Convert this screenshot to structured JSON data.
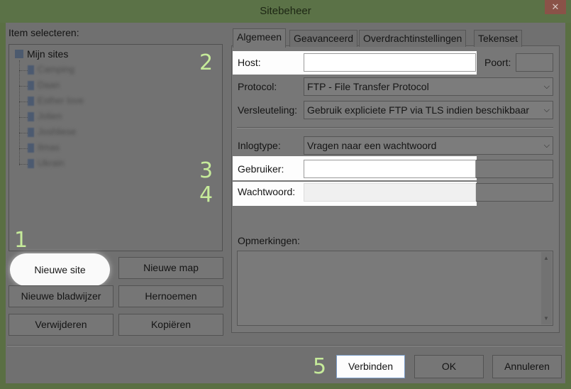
{
  "window": {
    "title": "Sitebeheer",
    "close_glyph": "✕"
  },
  "left": {
    "select_label": "Item selecteren:",
    "tree_root": "Mijn sites",
    "tree_items": [
      "Camping",
      "Daan",
      "Esther love",
      "Jolien",
      "Joshliese",
      "Ilmas",
      "Ukrain"
    ]
  },
  "buttons": {
    "new_site": "Nieuwe site",
    "new_folder": "Nieuwe map",
    "new_bookmark": "Nieuwe bladwijzer",
    "rename": "Hernoemen",
    "delete": "Verwijderen",
    "copy": "Kopiëren",
    "connect": "Verbinden",
    "ok": "OK",
    "cancel": "Annuleren"
  },
  "tabs": [
    "Algemeen",
    "Geavanceerd",
    "Overdrachtinstellingen",
    "Tekenset"
  ],
  "form": {
    "host_label": "Host:",
    "host_value": "",
    "port_label": "Poort:",
    "port_value": "",
    "protocol_label": "Protocol:",
    "protocol_value": "FTP - File Transfer Protocol",
    "encryption_label": "Versleuteling:",
    "encryption_value": "Gebruik expliciete FTP via TLS indien beschikbaar",
    "logintype_label": "Inlogtype:",
    "logintype_value": "Vragen naar een wachtwoord",
    "user_label": "Gebruiker:",
    "user_value": "",
    "password_label": "Wachtwoord:",
    "comments_label": "Opmerkingen:"
  },
  "steps": [
    "1",
    "2",
    "3",
    "4",
    "5"
  ],
  "colors": {
    "step_number": "#c6eb9a",
    "highlight": "#ffffff",
    "title_bar": "#5b7247"
  },
  "icons": {
    "dropdown": "chevron-down-icon",
    "scroll_up": "scroll-up-icon",
    "scroll_down": "scroll-down-icon"
  }
}
